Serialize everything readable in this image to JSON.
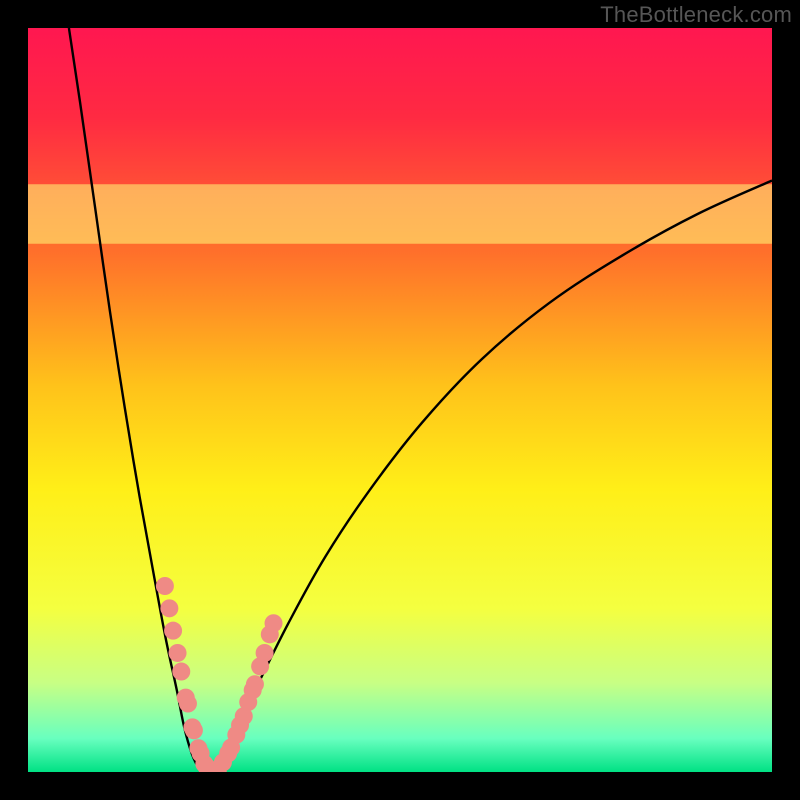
{
  "watermark": "TheBottleneck.com",
  "chart_data": {
    "type": "line",
    "title": "",
    "xlabel": "",
    "ylabel": "",
    "xlim": [
      0,
      100
    ],
    "ylim": [
      0,
      100
    ],
    "optimum_x": 24,
    "background_gradient": {
      "stops": [
        {
          "offset": 0.0,
          "color": "#ff1750"
        },
        {
          "offset": 0.12,
          "color": "#ff2a42"
        },
        {
          "offset": 0.3,
          "color": "#ff6f2b"
        },
        {
          "offset": 0.48,
          "color": "#ffc21a"
        },
        {
          "offset": 0.62,
          "color": "#ffef18"
        },
        {
          "offset": 0.78,
          "color": "#f4ff40"
        },
        {
          "offset": 0.88,
          "color": "#c8ff84"
        },
        {
          "offset": 0.955,
          "color": "#68ffbf"
        },
        {
          "offset": 1.0,
          "color": "#00e184"
        }
      ]
    },
    "yellow_band": {
      "y0": 71,
      "y1": 79,
      "color": "#ffff7a",
      "opacity": 0.55
    },
    "curve_left": {
      "x": [
        5.5,
        7,
        9,
        11,
        13,
        15,
        17,
        18.5,
        20,
        21,
        22,
        22.8,
        23.5
      ],
      "y": [
        100,
        90,
        76,
        62,
        49,
        37,
        26,
        18,
        11,
        6,
        2.5,
        0.8,
        0
      ]
    },
    "curve_right": {
      "x": [
        24.5,
        26,
        28,
        31,
        35,
        40,
        46,
        53,
        61,
        70,
        80,
        90,
        100
      ],
      "y": [
        0,
        2,
        6,
        12,
        20,
        29,
        38,
        47,
        55.5,
        63,
        69.5,
        75,
        79.5
      ]
    },
    "markers_left": {
      "x": [
        18.4,
        19.0,
        19.5,
        20.1,
        20.6,
        21.2,
        21.5,
        22.1,
        22.3,
        22.9,
        23.2,
        23.7,
        24.0,
        24.4,
        24.9,
        25.5
      ],
      "y": [
        25.0,
        22.0,
        19.0,
        16.0,
        13.5,
        10.0,
        9.2,
        6.0,
        5.6,
        3.2,
        2.5,
        1.1,
        0.7,
        0.35,
        0.15,
        0.05
      ]
    },
    "markers_right": {
      "x": [
        26.2,
        26.9,
        27.3,
        28.0,
        28.5,
        29.0,
        29.6,
        30.2,
        30.5,
        31.2,
        31.8,
        32.5,
        33.0
      ],
      "y": [
        1.3,
        2.5,
        3.3,
        5.0,
        6.3,
        7.5,
        9.4,
        11.0,
        11.8,
        14.2,
        16.0,
        18.5,
        20.0
      ]
    },
    "marker_color": "#ef8a85",
    "marker_radius": 9,
    "curve_color": "#000000",
    "curve_width": 2.4
  }
}
